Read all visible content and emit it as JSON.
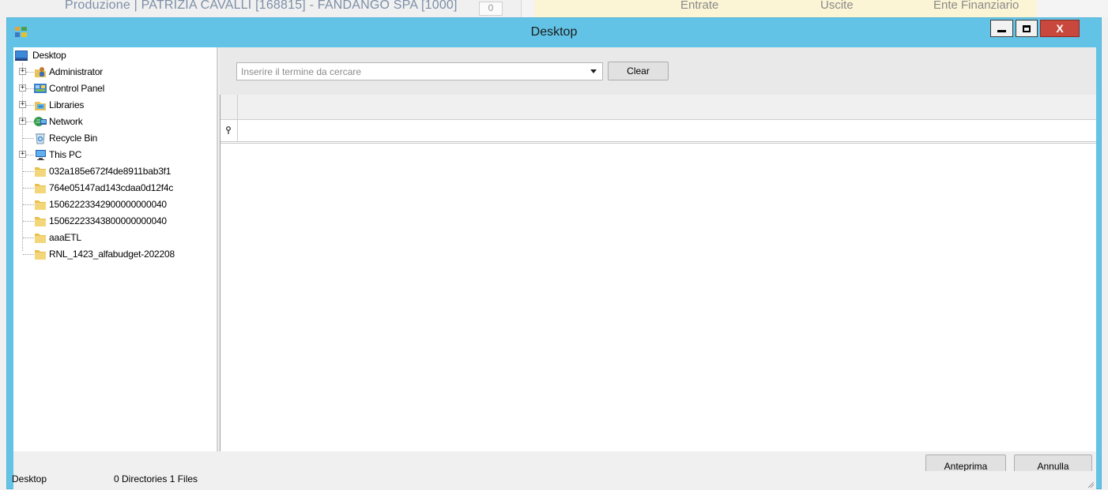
{
  "background_app": {
    "production_text": "Produzione | PATRIZIA CAVALLI [168815] - FANDANGO SPA [1000]",
    "box_value": "0",
    "columns": [
      "Entrate",
      "Uscite",
      "Ente Finanziario"
    ]
  },
  "window": {
    "title": "Desktop",
    "close_label": "X"
  },
  "tree": {
    "root": "Desktop",
    "items": [
      {
        "label": "Administrator",
        "icon": "user-folder-icon",
        "expandable": true
      },
      {
        "label": "Control Panel",
        "icon": "control-panel-icon",
        "expandable": true
      },
      {
        "label": "Libraries",
        "icon": "libraries-icon",
        "expandable": true
      },
      {
        "label": "Network",
        "icon": "network-icon",
        "expandable": true
      },
      {
        "label": "Recycle Bin",
        "icon": "recycle-bin-icon",
        "expandable": false
      },
      {
        "label": "This PC",
        "icon": "computer-icon",
        "expandable": true
      },
      {
        "label": "032a185e672f4de8911bab3f1",
        "icon": "folder-icon",
        "expandable": false
      },
      {
        "label": "764e05147ad143cdaa0d12f4c",
        "icon": "folder-icon",
        "expandable": false
      },
      {
        "label": "15062223342900000000040",
        "icon": "folder-icon",
        "expandable": false
      },
      {
        "label": "15062223343800000000040",
        "icon": "folder-icon",
        "expandable": false
      },
      {
        "label": "aaaETL",
        "icon": "folder-icon",
        "expandable": false
      },
      {
        "label": "RNL_1423_alfabudget-202208",
        "icon": "folder-icon",
        "expandable": false
      }
    ]
  },
  "search": {
    "placeholder": "Inserire il termine da cercare",
    "value": "",
    "clear_label": "Clear"
  },
  "footer": {
    "preview_label": "Anteprima",
    "cancel_label": "Annulla"
  },
  "status": {
    "location": "Desktop",
    "summary": "0 Directories 1 Files"
  }
}
